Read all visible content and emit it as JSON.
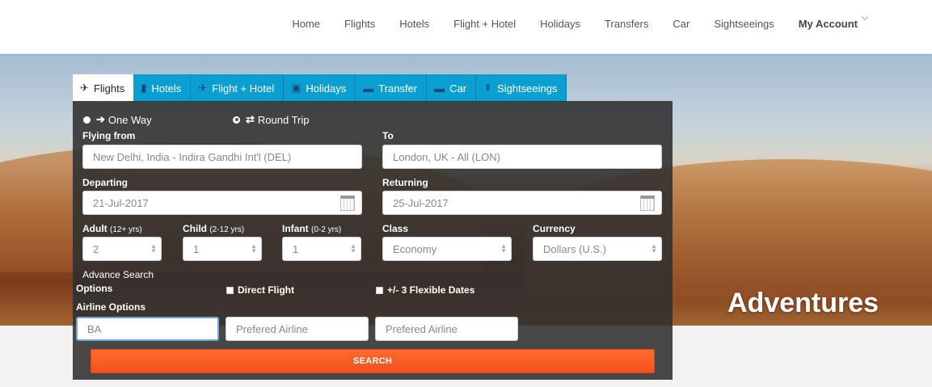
{
  "nav": {
    "items": [
      "Home",
      "Flights",
      "Hotels",
      "Flight + Hotel",
      "Holidays",
      "Transfers",
      "Car",
      "Sightseeings"
    ],
    "account": "My Account"
  },
  "hero": {
    "caption": "Adventures"
  },
  "tabs": [
    {
      "label": "Flights",
      "icon": "plane-icon",
      "active": true
    },
    {
      "label": "Hotels",
      "icon": "building-icon"
    },
    {
      "label": "Flight + Hotel",
      "icon": "plane-icon"
    },
    {
      "label": "Holidays",
      "icon": "suitcase-icon"
    },
    {
      "label": "Transfer",
      "icon": "bus-icon"
    },
    {
      "label": "Car",
      "icon": "car-icon"
    },
    {
      "label": "Sightseeings",
      "icon": "signpost-icon"
    }
  ],
  "trip": {
    "one_way": "One Way",
    "round_trip": "Round Trip",
    "selected": "round_trip"
  },
  "form": {
    "from_label": "Flying from",
    "from_placeholder": "New Delhi, India - Indira Gandhi Int'l (DEL)",
    "to_label": "To",
    "to_placeholder": "London, UK - All (LON)",
    "depart_label": "Departing",
    "depart_value": "21-Jul-2017",
    "return_label": "Returning",
    "return_value": "25-Jul-2017",
    "adult_label": "Adult",
    "adult_sub": "(12+ yrs)",
    "adult_value": "2",
    "child_label": "Child",
    "child_sub": "(2-12 yrs)",
    "child_value": "1",
    "infant_label": "Infant",
    "infant_sub": "(0-2 yrs)",
    "infant_value": "1",
    "class_label": "Class",
    "class_value": "Economy",
    "currency_label": "Currency",
    "currency_value": "Dollars (U.S.)",
    "advance_label_1": "Advance Search",
    "advance_label_2": "Options",
    "direct_flight": "Direct Flight",
    "flexible_dates": "+/- 3 Flexible Dates",
    "airline_label": "Airline Options",
    "airline_1_value": "BA",
    "airline_2_placeholder": "Prefered Airline",
    "airline_3_placeholder": "Prefered Airline",
    "search_label": "SEARCH"
  },
  "colors": {
    "tab_blue": "#0a9fd0",
    "search_orange": "#f2511e",
    "panel_bg": "#2f2f2f"
  }
}
